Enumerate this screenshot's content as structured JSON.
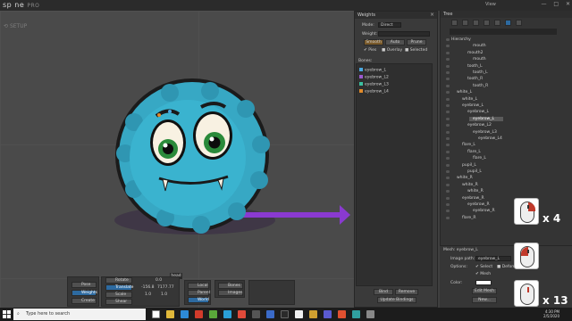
{
  "app": {
    "logo": "sp ne",
    "logo_pro": "PRO",
    "mode": "SETUP",
    "view_title": "View",
    "window_controls": [
      "—",
      "□",
      "✕"
    ]
  },
  "viewport": {
    "readout": "head"
  },
  "toolbar": {
    "tools": [
      "Pose",
      "Weights",
      "Create"
    ],
    "transform": {
      "rotate_label": "Rotate",
      "rotate_val": "0.0",
      "translate_label": "Translate",
      "translate_x": "-156.8",
      "translate_y": "7177.77",
      "scale_label": "Scale",
      "scale_x": "1.0",
      "scale_y": "1.0",
      "shear_label": "Shear"
    },
    "axes": [
      "Local",
      "Parent",
      "World"
    ],
    "options": [
      "Bones",
      "Images"
    ]
  },
  "weights": {
    "title": "Weights",
    "mode_label": "Mode:",
    "mode_value": "Direct",
    "weight_label": "Weight:",
    "buttons": [
      "Smooth",
      "Auto",
      "Prune"
    ],
    "checks": [
      "Pies",
      "Overlay",
      "Selected"
    ],
    "bones_label": "Bones:",
    "bones": [
      {
        "name": "eyebrow_L",
        "color": "#4aa8e0"
      },
      {
        "name": "eyebrow_L2",
        "color": "#9b59d0"
      },
      {
        "name": "eyebrow_L3",
        "color": "#3cc0a0"
      },
      {
        "name": "eyebrow_L4",
        "color": "#e08a2a"
      }
    ],
    "bind_label": "Bind",
    "remove_label": "Remove",
    "update_label": "Update Bindings"
  },
  "tree": {
    "title": "Tree",
    "nodes": [
      {
        "label": "Hierarchy",
        "depth": 0
      },
      {
        "label": "mouth",
        "depth": 4
      },
      {
        "label": "mouth2",
        "depth": 3
      },
      {
        "label": "mouth",
        "depth": 4
      },
      {
        "label": "tooth_L",
        "depth": 3
      },
      {
        "label": "tooth_L",
        "depth": 4
      },
      {
        "label": "tooth_R",
        "depth": 3
      },
      {
        "label": "tooth_R",
        "depth": 4
      },
      {
        "label": "white_L",
        "depth": 1
      },
      {
        "label": "white_L",
        "depth": 2
      },
      {
        "label": "eyebrow_L",
        "depth": 2
      },
      {
        "label": "eyebrow_L",
        "depth": 3
      },
      {
        "label": "eyebrow_L",
        "depth": 4,
        "selected": true
      },
      {
        "label": "eyebrow_L2",
        "depth": 3
      },
      {
        "label": "eyebrow_L3",
        "depth": 4
      },
      {
        "label": "eyebrow_L4",
        "depth": 5
      },
      {
        "label": "flare_L",
        "depth": 2
      },
      {
        "label": "flare_L",
        "depth": 3
      },
      {
        "label": "flare_L",
        "depth": 4
      },
      {
        "label": "pupil_L",
        "depth": 2
      },
      {
        "label": "pupil_L",
        "depth": 3
      },
      {
        "label": "white_R",
        "depth": 1
      },
      {
        "label": "white_R",
        "depth": 2
      },
      {
        "label": "white_R",
        "depth": 3
      },
      {
        "label": "eyebrow_R",
        "depth": 2
      },
      {
        "label": "eyebrow_R",
        "depth": 3
      },
      {
        "label": "eyebrow_R",
        "depth": 4
      },
      {
        "label": "flare_R",
        "depth": 2
      }
    ]
  },
  "mesh": {
    "title": "Mesh: eyebrow_L",
    "image_path_label": "Image path:",
    "image_path_value": "eyebrow_L",
    "options_label": "Options:",
    "opt_select": "Select",
    "opt_deform": "Deform",
    "opt_mesh": "Mesh",
    "color_label": "Color:",
    "edit_mesh": "Edit Mesh",
    "new_label": "New..."
  },
  "overlays": {
    "mouse_counts": [
      "x 4",
      "x 13"
    ]
  },
  "taskbar": {
    "search_placeholder": "Type here to search",
    "time": "4:30 PM",
    "date": "2/5/2020"
  }
}
